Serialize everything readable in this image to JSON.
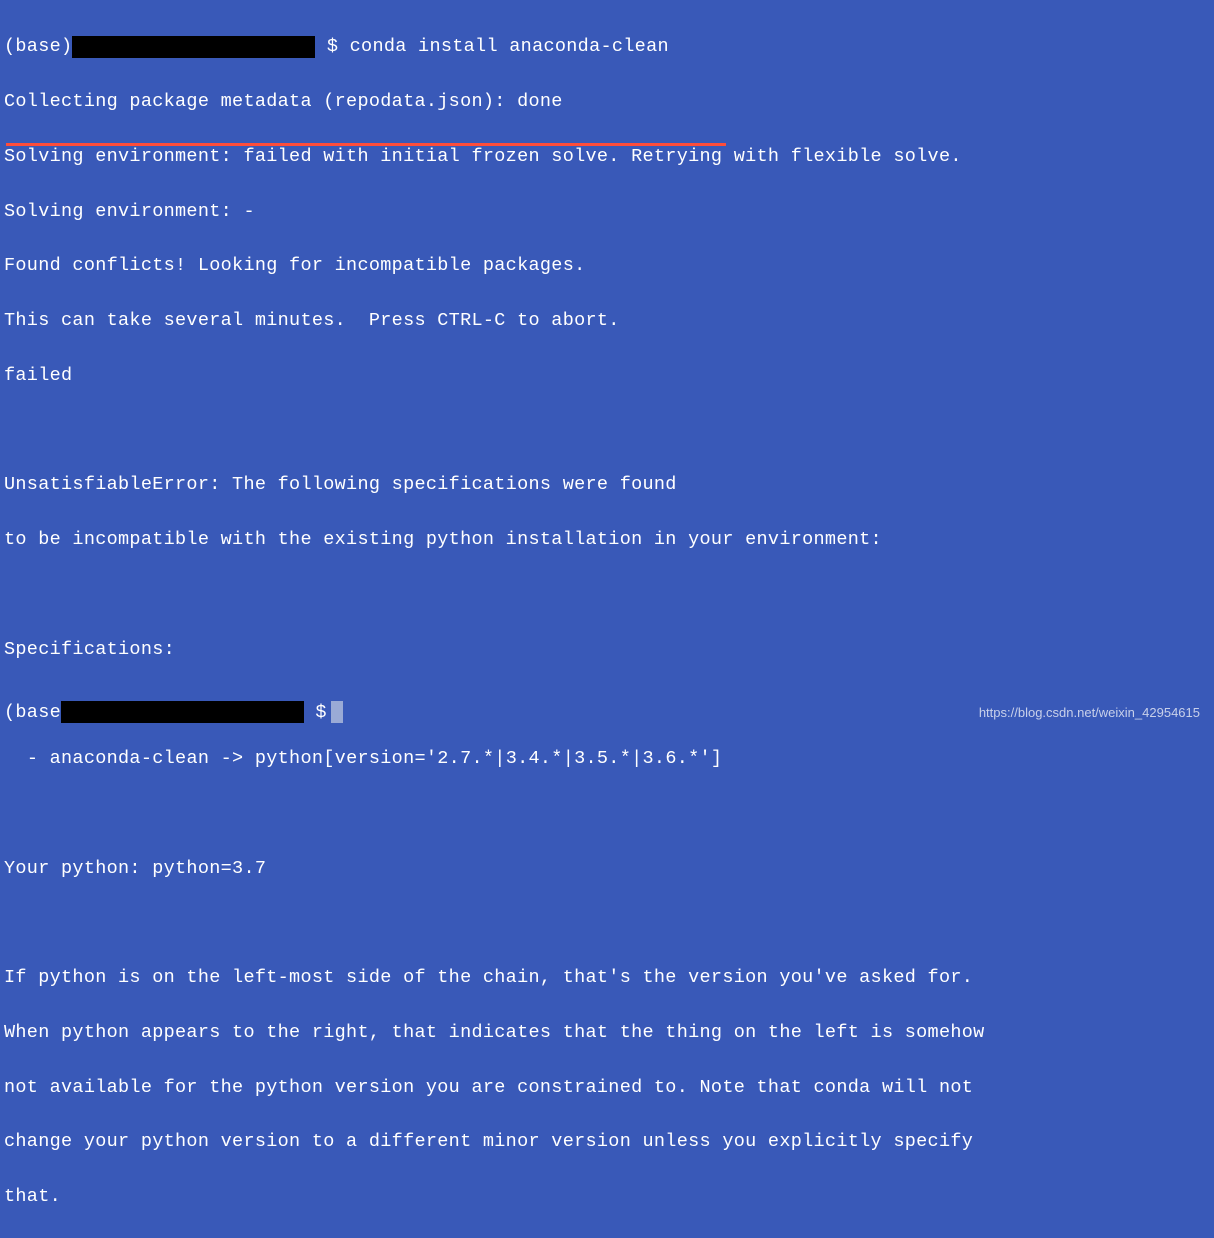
{
  "prompt1": {
    "env": "(base)",
    "symbol": "$",
    "command": "conda install anaconda-clean"
  },
  "output": {
    "line1": "Collecting package metadata (repodata.json): done",
    "line2": "Solving environment: failed with initial frozen solve. Retrying with flexible solve.",
    "line3": "Solving environment: -",
    "line4": "Found conflicts! Looking for incompatible packages.",
    "line5": "This can take several minutes.  Press CTRL-C to abort.",
    "line6": "failed",
    "line7": "",
    "line8": "UnsatisfiableError: The following specifications were found",
    "line9": "to be incompatible with the existing python installation in your environment:",
    "line10": "",
    "line11": "Specifications:",
    "line12": "",
    "line13": "  - anaconda-clean -> python[version='2.7.*|3.4.*|3.5.*|3.6.*']",
    "line14": "",
    "line15": "Your python: python=3.7",
    "line16": "",
    "line17": "If python is on the left-most side of the chain, that's the version you've asked for.",
    "line18": "When python appears to the right, that indicates that the thing on the left is somehow",
    "line19": "not available for the python version you are constrained to. Note that conda will not",
    "line20": "change your python version to a different minor version unless you explicitly specify",
    "line21": "that."
  },
  "prompt2": {
    "env": "(base",
    "symbol": "$"
  },
  "watermark": "https://blog.csdn.net/weixin_42954615"
}
